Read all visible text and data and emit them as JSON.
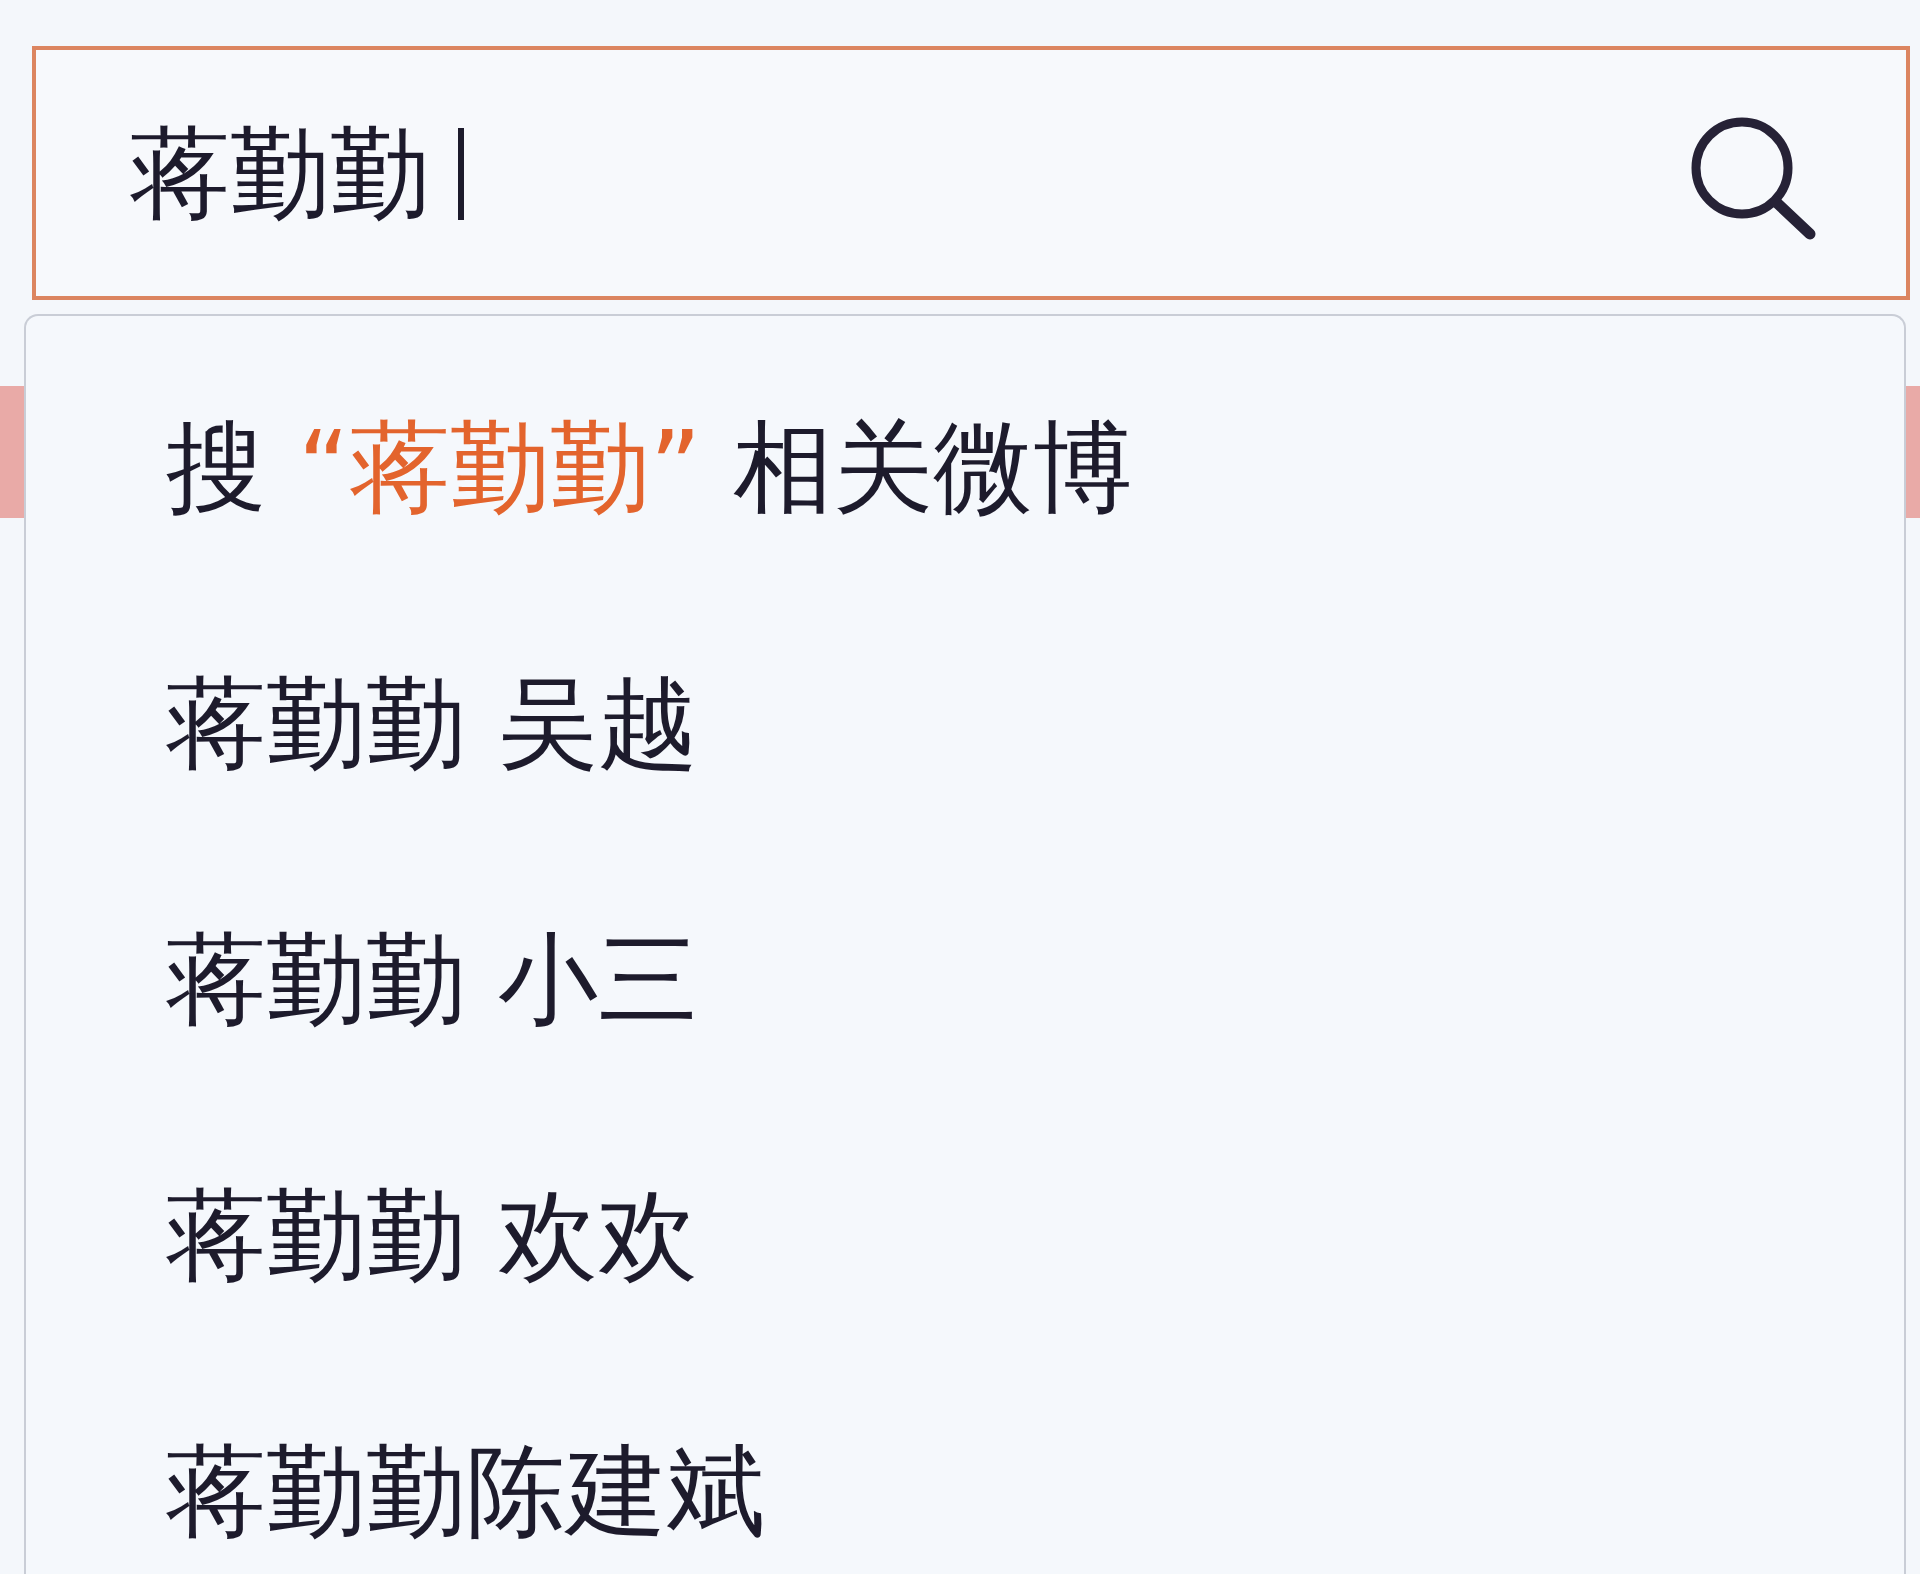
{
  "search": {
    "value": "蒋勤勤",
    "focused": true
  },
  "suggestions": [
    {
      "kind": "search_all",
      "prefix": "搜",
      "keyword": "“蒋勤勤”",
      "suffix": "相关微博"
    },
    {
      "kind": "query",
      "text": "蒋勤勤 吴越"
    },
    {
      "kind": "query",
      "text": "蒋勤勤 小三"
    },
    {
      "kind": "query",
      "text": "蒋勤勤 欢欢"
    },
    {
      "kind": "query",
      "text": "蒋勤勤陈建斌"
    }
  ]
}
